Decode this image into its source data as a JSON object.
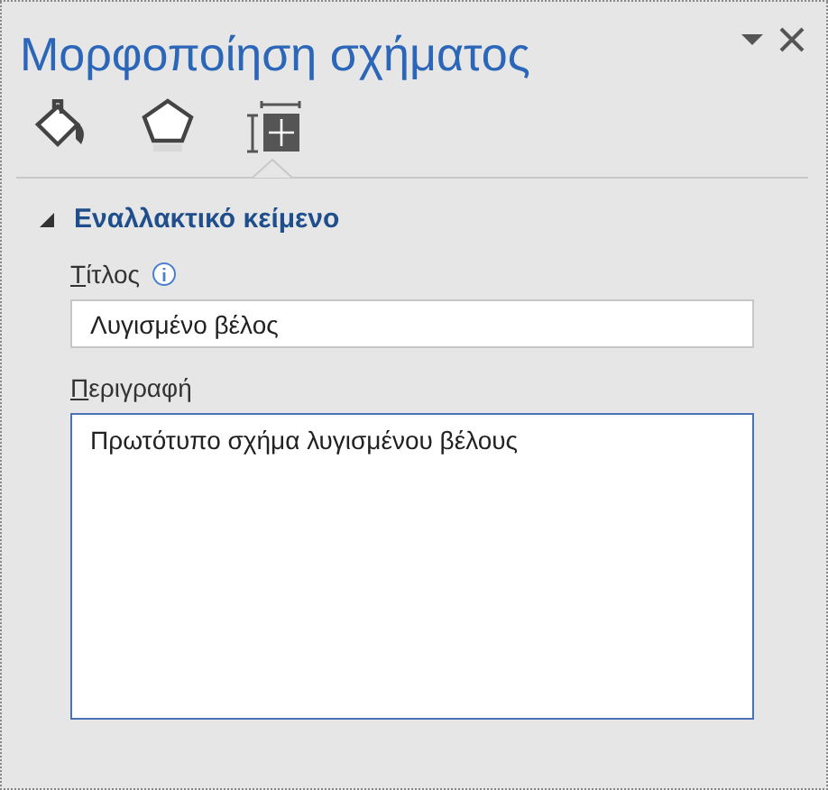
{
  "pane": {
    "title": "Μορφοποίηση σχήματος"
  },
  "tabs": [
    {
      "kind": "fill",
      "selected": false
    },
    {
      "kind": "effects",
      "selected": false
    },
    {
      "kind": "layout",
      "selected": true
    }
  ],
  "section": {
    "title": "Εναλλακτικό κείμενο",
    "expanded": true
  },
  "title_field": {
    "label": "Τίτλος",
    "value": "Λυγισμένο βέλος"
  },
  "description_field": {
    "label": "Περιγραφή",
    "value": "Πρωτότυπο σχήμα λυγισμένου βέλους"
  }
}
